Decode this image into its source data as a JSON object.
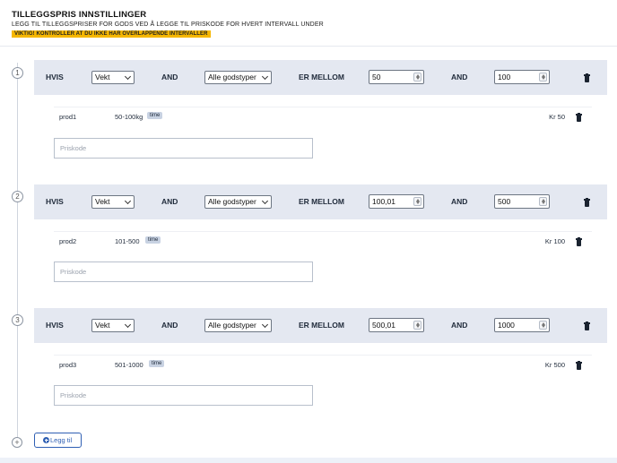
{
  "header": {
    "title": "TILLEGGSPRIS INNSTILLINGER",
    "subtitle": "LEGG TIL TILLEGGSPRISER FOR GODS VED Å LEGGE TIL PRISKODE FOR HVERT INTERVALL UNDER",
    "warning": "VIKTIG! KONTROLLER AT DU IKKE HAR OVERLAPPENDE INTERVALLER",
    "warning_color": "#f6b700"
  },
  "labels": {
    "if": "HVIS",
    "and": "AND",
    "between": "ER MELLOM",
    "pricecode_placeholder": "Priskode",
    "add_button": "Legg til"
  },
  "rules": [
    {
      "number": "1",
      "measure": "Vekt",
      "goods_type": "Alle godstyper",
      "from": "50",
      "to": "100",
      "product": {
        "name": "prod1",
        "range": "50-100kg",
        "badge": "time",
        "price": "Kr 50"
      },
      "pricecode": ""
    },
    {
      "number": "2",
      "measure": "Vekt",
      "goods_type": "Alle godstyper",
      "from": "100,01",
      "to": "500",
      "product": {
        "name": "prod2",
        "range": "101-500",
        "badge": "time",
        "price": "Kr 100"
      },
      "pricecode": ""
    },
    {
      "number": "3",
      "measure": "Vekt",
      "goods_type": "Alle godstyper",
      "from": "500,01",
      "to": "1000",
      "product": {
        "name": "prod3",
        "range": "501-1000",
        "badge": "time",
        "price": "Kr 500"
      },
      "pricecode": ""
    }
  ],
  "add_marker": "+",
  "colors": {
    "accent": "#2f5fb3",
    "rule_bg": "#e4e8f1",
    "badge_bg": "#c8d2e2"
  },
  "icons": {
    "delete": "trash-icon",
    "add": "plus-circle-icon"
  }
}
